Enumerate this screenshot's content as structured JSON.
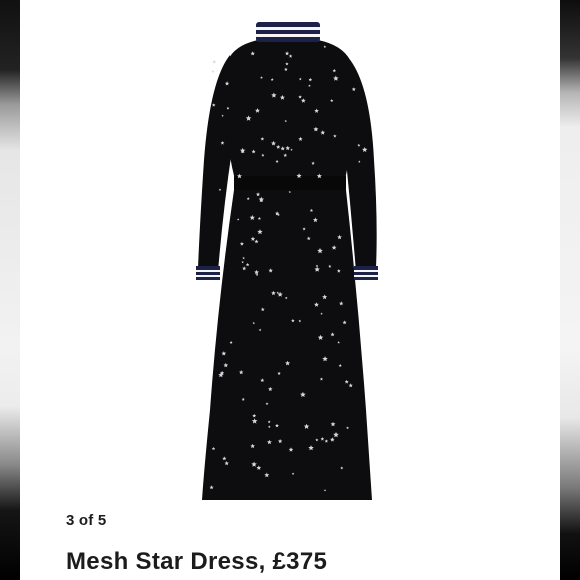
{
  "gallery": {
    "counter_text": "3 of 5",
    "product_title": "Mesh Star Dress, £375"
  },
  "colors": {
    "dress": "#0d0d0f",
    "stars": "#d9d9dc",
    "stripe_navy": "#1b2147",
    "stripe_white": "#f5f5f5",
    "text": "#1c1c1c"
  },
  "icons": {
    "image": "dress-product-photo"
  }
}
